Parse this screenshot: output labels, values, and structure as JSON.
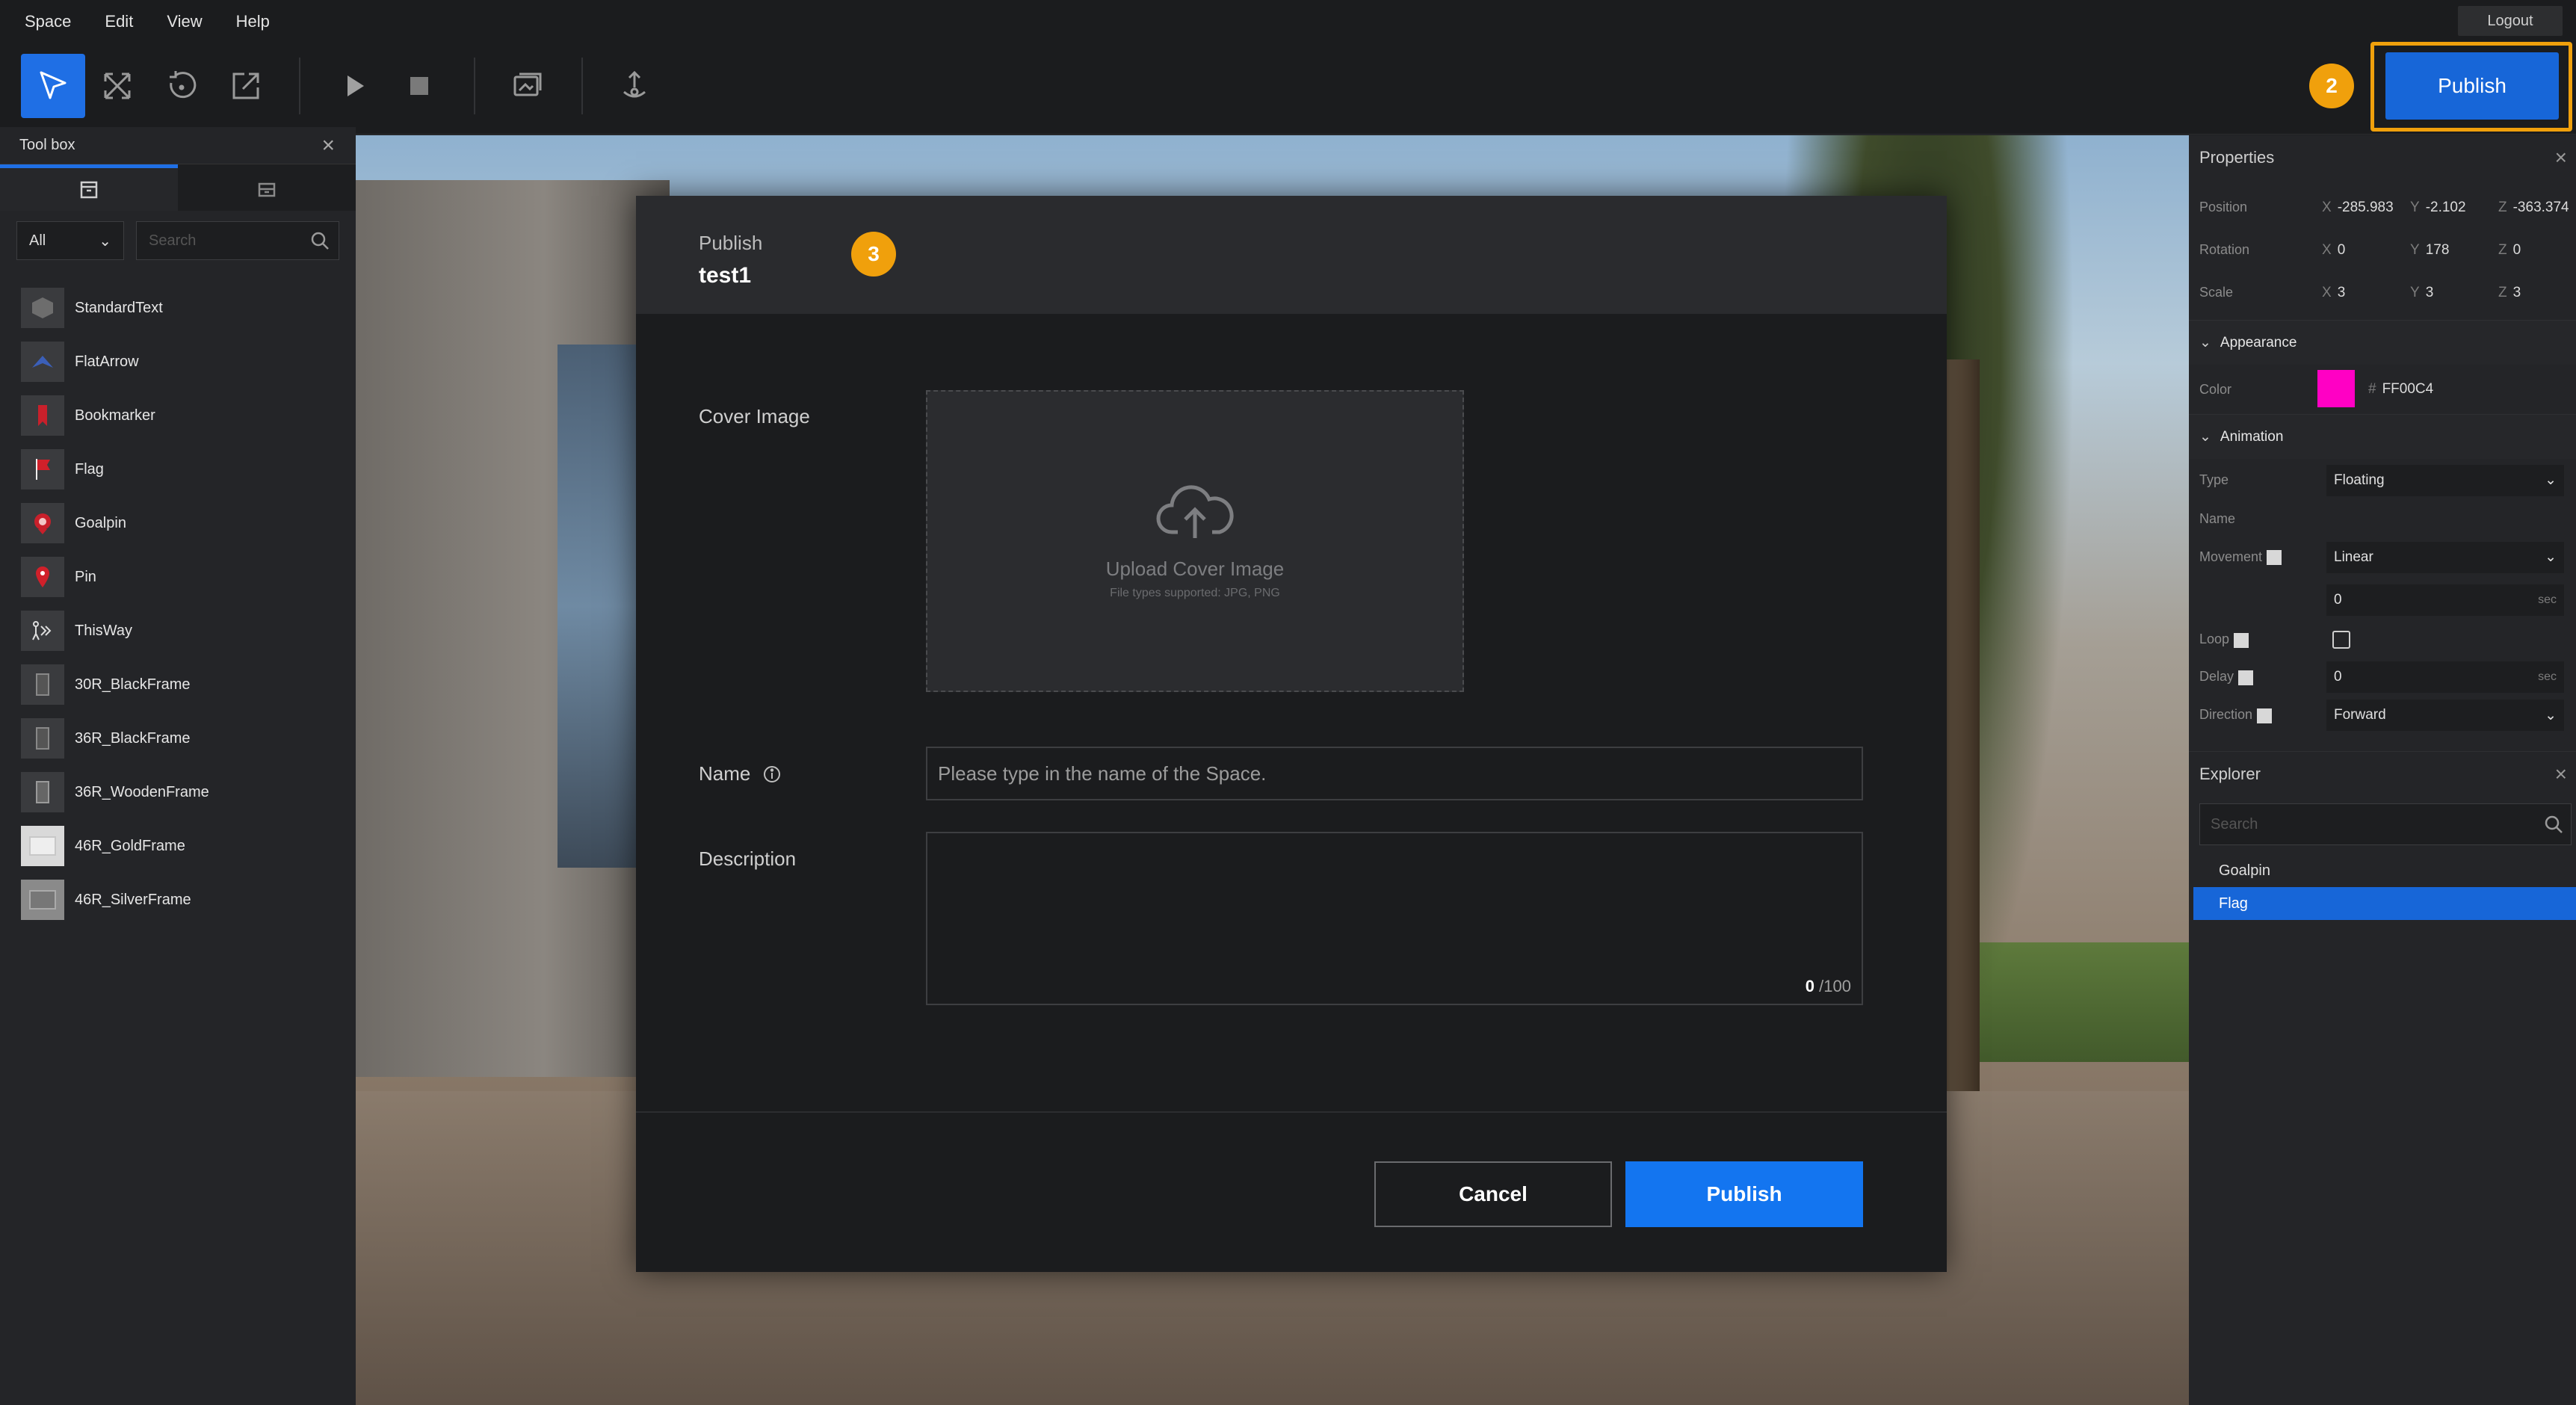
{
  "menubar": {
    "items": [
      "Space",
      "Edit",
      "View",
      "Help"
    ],
    "logout_label": "Logout"
  },
  "toolbar": {
    "tools": [
      "select-icon",
      "move-icon",
      "rotate-icon",
      "scale-icon",
      "play-icon",
      "stop-icon",
      "camera-icon",
      "export-icon"
    ],
    "step_badge": "2",
    "publish_label": "Publish"
  },
  "toolbox": {
    "title": "Tool box",
    "filter_value": "All",
    "search_placeholder": "Search",
    "items": [
      {
        "label": "StandardText"
      },
      {
        "label": "FlatArrow"
      },
      {
        "label": "Bookmarker"
      },
      {
        "label": "Flag"
      },
      {
        "label": "Goalpin"
      },
      {
        "label": "Pin"
      },
      {
        "label": "ThisWay"
      },
      {
        "label": "30R_BlackFrame"
      },
      {
        "label": "36R_BlackFrame"
      },
      {
        "label": "36R_WoodenFrame"
      },
      {
        "label": "46R_GoldFrame"
      },
      {
        "label": "46R_SilverFrame"
      }
    ]
  },
  "modal": {
    "kicker": "Publish",
    "title": "test1",
    "step_badge": "3",
    "cover_label": "Cover Image",
    "cover_upload": "Upload Cover Image",
    "cover_types": "File types supported: JPG, PNG",
    "name_label": "Name",
    "name_placeholder": "Please type in the name of the Space.",
    "description_label": "Description",
    "char_count": "0",
    "char_max": "/100",
    "cancel_label": "Cancel",
    "publish_label": "Publish"
  },
  "properties": {
    "title": "Properties",
    "position": {
      "label": "Position",
      "x": "-285.983",
      "y": "-2.102",
      "z": "-363.374"
    },
    "rotation": {
      "label": "Rotation",
      "x": "0",
      "y": "178",
      "z": "0"
    },
    "scale": {
      "label": "Scale",
      "x": "3",
      "y": "3",
      "z": "3"
    },
    "appearance": {
      "title": "Appearance",
      "color_label": "Color",
      "color_hex": "FF00C4",
      "color": "#ff00c4"
    },
    "animation": {
      "title": "Animation",
      "type_label": "Type",
      "type_value": "Floating",
      "name_label": "Name",
      "movement_label": "Movement",
      "movement_value": "Linear",
      "duration_value": "0",
      "unit": "sec",
      "loop_label": "Loop",
      "delay_label": "Delay",
      "delay_value": "0",
      "direction_label": "Direction",
      "direction_value": "Forward"
    }
  },
  "explorer": {
    "title": "Explorer",
    "search_placeholder": "Search",
    "items": [
      "Goalpin",
      "Flag"
    ],
    "selected": "Flag"
  },
  "colors": {
    "accent": "#1f6fe5",
    "badge": "#f0a00c"
  }
}
